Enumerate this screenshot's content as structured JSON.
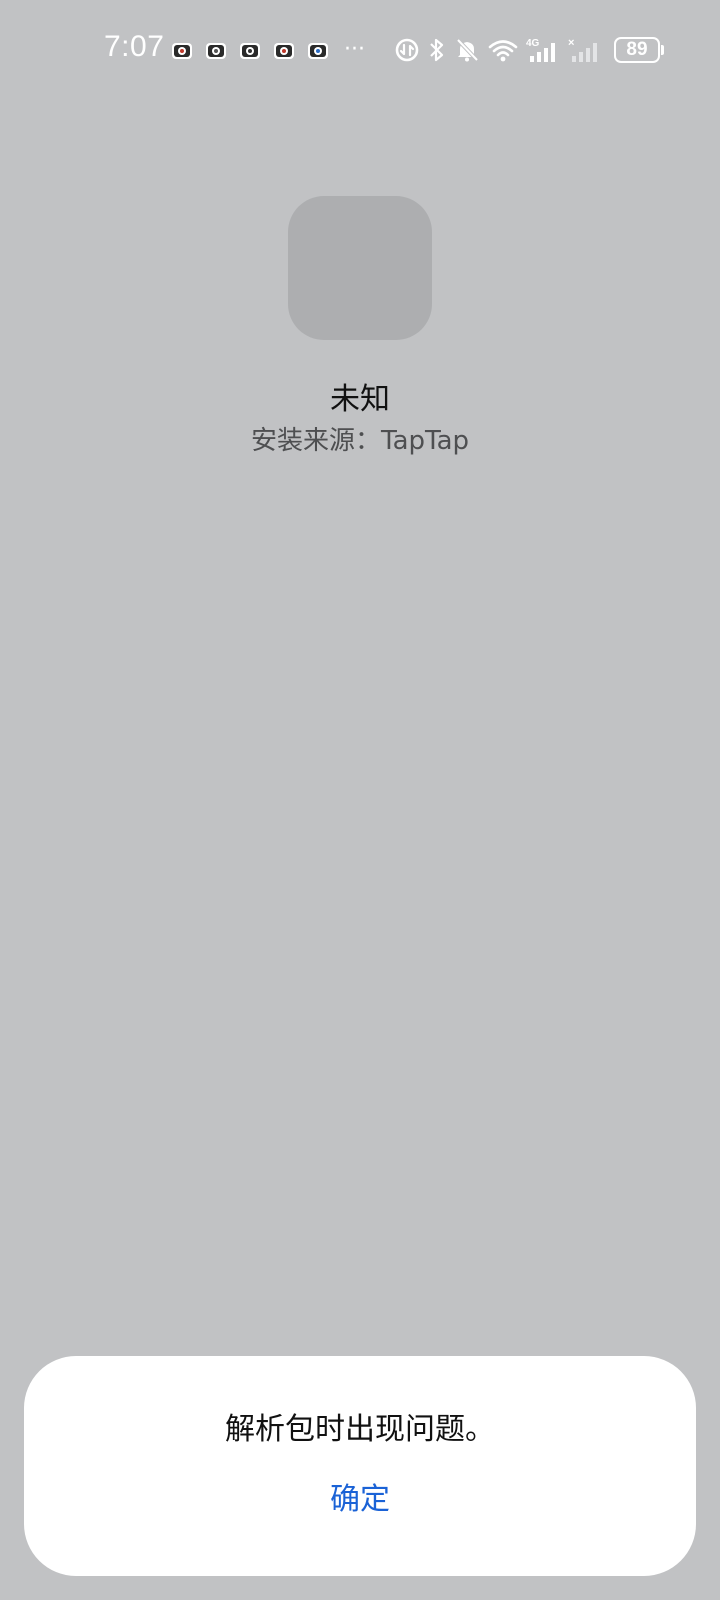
{
  "status_bar": {
    "time": "7:07",
    "notification_icons": [
      "game-app-icon",
      "game-app-icon",
      "game-app-icon",
      "game-app-icon",
      "game-app-icon"
    ],
    "more": "···",
    "battery_level": "89",
    "icons": [
      "data-saver-icon",
      "bluetooth-icon",
      "silent-bell-icon",
      "wifi-icon",
      "4g-signal-icon",
      "no-signal-icon",
      "battery-icon"
    ]
  },
  "app": {
    "name": "未知",
    "install_source": "安装来源：TapTap"
  },
  "dialog": {
    "message": "解析包时出现问题。",
    "confirm_label": "确定"
  },
  "colors": {
    "background": "#c1c2c4",
    "icon_placeholder": "#adaeb0",
    "dialog_bg": "#ffffff",
    "accent": "#1a62d6"
  }
}
